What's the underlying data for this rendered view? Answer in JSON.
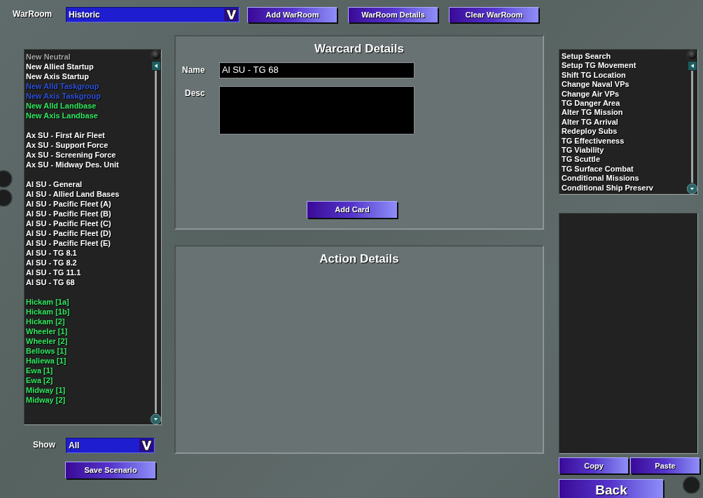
{
  "toolbar": {
    "warroom_label": "WarRoom",
    "warroom_select": {
      "value": "Historic"
    },
    "buttons": [
      "Add WarRoom",
      "WarRoom Details",
      "Clear WarRoom"
    ]
  },
  "left_list": {
    "groups": [
      {
        "items": [
          {
            "label": "New Neutral",
            "color": "#a6a6a6"
          },
          {
            "label": "New Allied Startup",
            "color": "#ffffff"
          },
          {
            "label": "New Axis Startup",
            "color": "#ffffff"
          },
          {
            "label": "New Alld Taskgroup",
            "color": "#2d50d8"
          },
          {
            "label": "New Axis Taskgroup",
            "color": "#2d50d8"
          },
          {
            "label": "New Alld Landbase",
            "color": "#30e860"
          },
          {
            "label": "New Axis Landbase",
            "color": "#30e860"
          }
        ]
      },
      {
        "items": [
          {
            "label": "Ax SU - First Air Fleet",
            "color": "#ffffff"
          },
          {
            "label": "Ax SU - Support Force",
            "color": "#ffffff"
          },
          {
            "label": "Ax SU - Screening Force",
            "color": "#ffffff"
          },
          {
            "label": "Ax SU - Midway Des. Unit",
            "color": "#ffffff"
          }
        ]
      },
      {
        "items": [
          {
            "label": "Al SU - General",
            "color": "#ffffff"
          },
          {
            "label": "Al SU - Allied Land Bases",
            "color": "#ffffff"
          },
          {
            "label": "Al SU - Pacific Fleet (A)",
            "color": "#ffffff"
          },
          {
            "label": "Al SU - Pacific Fleet (B)",
            "color": "#ffffff"
          },
          {
            "label": "Al SU - Pacific Fleet (C)",
            "color": "#ffffff"
          },
          {
            "label": "Al SU - Pacific Fleet (D)",
            "color": "#ffffff"
          },
          {
            "label": "Al SU - Pacific Fleet (E)",
            "color": "#ffffff"
          },
          {
            "label": "Al SU - TG 8.1",
            "color": "#ffffff"
          },
          {
            "label": "Al SU - TG 8.2",
            "color": "#ffffff"
          },
          {
            "label": "Al SU - TG 11.1",
            "color": "#ffffff"
          },
          {
            "label": "Al SU - TG 68",
            "color": "#ffffff"
          }
        ]
      },
      {
        "items": [
          {
            "label": "Hickam [1a]",
            "color": "#30e860"
          },
          {
            "label": "Hickam [1b]",
            "color": "#30e860"
          },
          {
            "label": "Hickam [2]",
            "color": "#30e860"
          },
          {
            "label": "Wheeler [1]",
            "color": "#30e860"
          },
          {
            "label": "Wheeler [2]",
            "color": "#30e860"
          },
          {
            "label": "Bellows [1]",
            "color": "#30e860"
          },
          {
            "label": "Haliewa [1]",
            "color": "#30e860"
          },
          {
            "label": "Ewa [1]",
            "color": "#30e860"
          },
          {
            "label": "Ewa [2]",
            "color": "#30e860"
          },
          {
            "label": "Midway [1]",
            "color": "#30e860"
          },
          {
            "label": "Midway [2]",
            "color": "#30e860"
          }
        ]
      }
    ]
  },
  "show": {
    "label": "Show",
    "select": {
      "value": "All"
    }
  },
  "save_button": "Save Scenario",
  "warcard": {
    "title": "Warcard Details",
    "name_label": "Name",
    "name_value": "Al SU - TG 68",
    "desc_label": "Desc",
    "add_button": "Add Card"
  },
  "action_details": {
    "title": "Action Details"
  },
  "action_list": {
    "items": [
      "Setup Search",
      "Setup TG Movement",
      "Shift TG Location",
      "Change Naval VPs",
      "Change Air VPs",
      "TG Danger Area",
      "Alter TG Mission",
      "Alter TG Arrival",
      "Redeploy Subs",
      "TG Effectiveness",
      "TG Viability",
      "TG Scuttle",
      "TG Surface Combat",
      "Conditional Missions",
      "Conditional Ship Preserv"
    ]
  },
  "copy_button": "Copy",
  "paste_button": "Paste",
  "back_button": "Back"
}
